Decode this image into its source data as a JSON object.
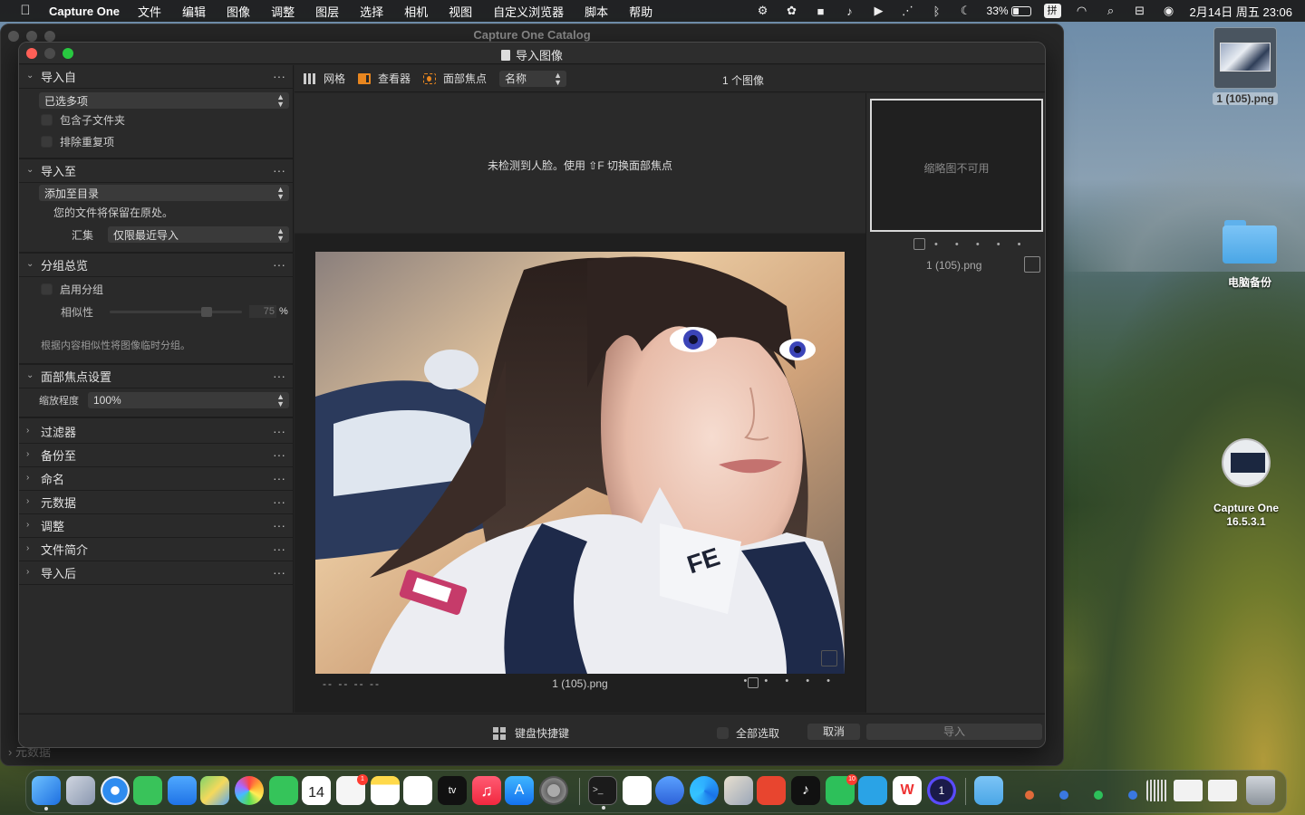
{
  "menubar": {
    "app_name": "Capture One",
    "items": [
      "文件",
      "编辑",
      "图像",
      "调整",
      "图层",
      "选择",
      "相机",
      "视图",
      "自定义浏览器",
      "脚本",
      "帮助"
    ],
    "battery": "33%",
    "ime": "拼",
    "clock": "2月14日 周五  23:06"
  },
  "bg_window": {
    "title": "Capture One Catalog",
    "bottom_label": "元数据"
  },
  "dialog": {
    "title": "导入图像",
    "left_panel": {
      "import_from": {
        "title": "导入自",
        "source_value": "已选多项",
        "include_subfolders": "包含子文件夹",
        "exclude_duplicates": "排除重复项"
      },
      "import_to": {
        "title": "导入至",
        "dest_value": "添加至目录",
        "note": "您的文件将保留在原处。",
        "collection_label": "汇集",
        "collection_value": "仅限最近导入"
      },
      "grouping": {
        "title": "分组总览",
        "enable_label": "启用分组",
        "similarity_label": "相似性",
        "similarity_value": "75",
        "similarity_unit": "%",
        "similarity_fraction": 0.75,
        "hint": "根据内容相似性将图像临时分组。"
      },
      "face_focus": {
        "title": "面部焦点设置",
        "zoom_label": "缩放程度",
        "zoom_value": "100%"
      },
      "collapsed_sections": [
        "过滤器",
        "备份至",
        "命名",
        "元数据",
        "调整",
        "文件简介",
        "导入后"
      ]
    },
    "toolbar": {
      "grid_label": "网格",
      "viewer_label": "查看器",
      "face_label": "面部焦点",
      "sort_value": "名称",
      "image_count": "1 个图像"
    },
    "face_message": "未检测到人脸。使用 ⇧F 切换面部焦点",
    "viewer": {
      "placeholder_dashes": "--   --   --   --",
      "filename": "1 (105).png",
      "stars": "• • • • •"
    },
    "browser": {
      "thumb_unavailable": "缩略图不可用",
      "stars": "• • • • •",
      "filename": "1 (105).png"
    },
    "bottom": {
      "shortcuts": "键盘快捷键",
      "select_all": "全部选取",
      "cancel": "取消",
      "import": "导入"
    }
  },
  "desktop": {
    "file_label": "1 (105).png",
    "folder_label": "电脑备份",
    "app_label_line1": "Capture One",
    "app_label_line2": "16.5.3.1"
  },
  "dock": {
    "calendar_day": "14",
    "reminders_badge": "1",
    "wechat_badge": "10"
  }
}
